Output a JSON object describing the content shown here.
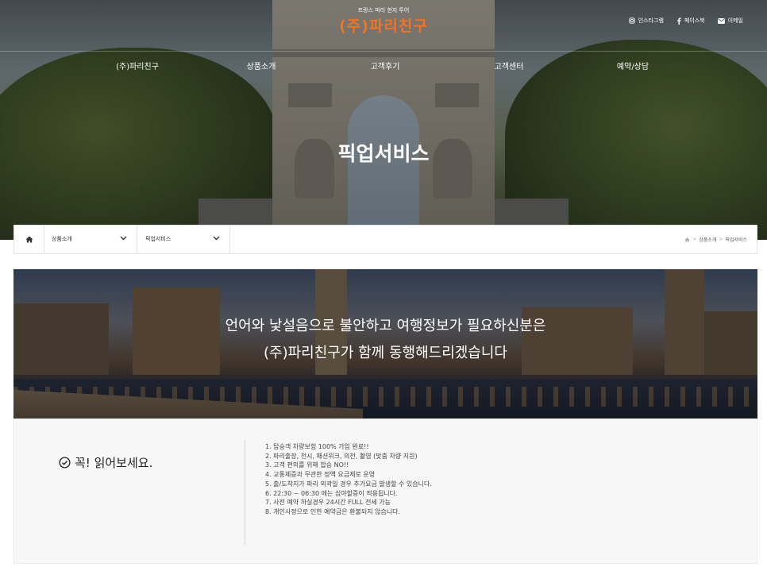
{
  "header": {
    "tagline": "프랑스 파리 현지 투어",
    "logo": "(주)파리친구",
    "social": [
      {
        "icon": "instagram-icon",
        "label": "인스타그램"
      },
      {
        "icon": "facebook-icon",
        "label": "페이스북"
      },
      {
        "icon": "mail-icon",
        "label": "이메일"
      }
    ]
  },
  "nav": {
    "items": [
      "(주)파리친구",
      "상품소개",
      "고객후기",
      "고객센터",
      "예약/상담"
    ]
  },
  "hero": {
    "title": "픽업서비스"
  },
  "breadcrumb": {
    "home_icon": "home-icon",
    "select_1": "상품소개",
    "select_2": "픽업서비스",
    "trail": [
      "상품소개",
      "픽업서비스"
    ]
  },
  "banner": {
    "line1": "언어와 낯설음으로 불안하고 여행정보가 필요하신분은",
    "line2": "(주)파리친구가 함께 동행해드리겠습니다"
  },
  "notice": {
    "icon": "check-circle-icon",
    "title": "꼭! 읽어보세요.",
    "items": [
      "1. 탑승객 차량보험 100% 가입 완료!!",
      "2. 파리출장, 전시, 패션위크, 의전, 촬영 (맞춤 차량 지원)",
      "3. 고객 편의를 위해 합승 NO!!",
      "4. 교통체증과 무관한 정액 요금제로 운영",
      "5. 출/도착지가 파리 외곽일 경우 추가요금 발생할 수 있습니다.",
      "6. 22:30 ~ 06:30 에는 심야할증이 적용됩니다.",
      "7. 사전 예약 하실경우 24시간 FULL 전세 가능",
      "8. 개인사정으로 인한 예약금은 환불되지 않습니다."
    ]
  },
  "colors": {
    "accent": "#f37320",
    "text": "#222222"
  }
}
